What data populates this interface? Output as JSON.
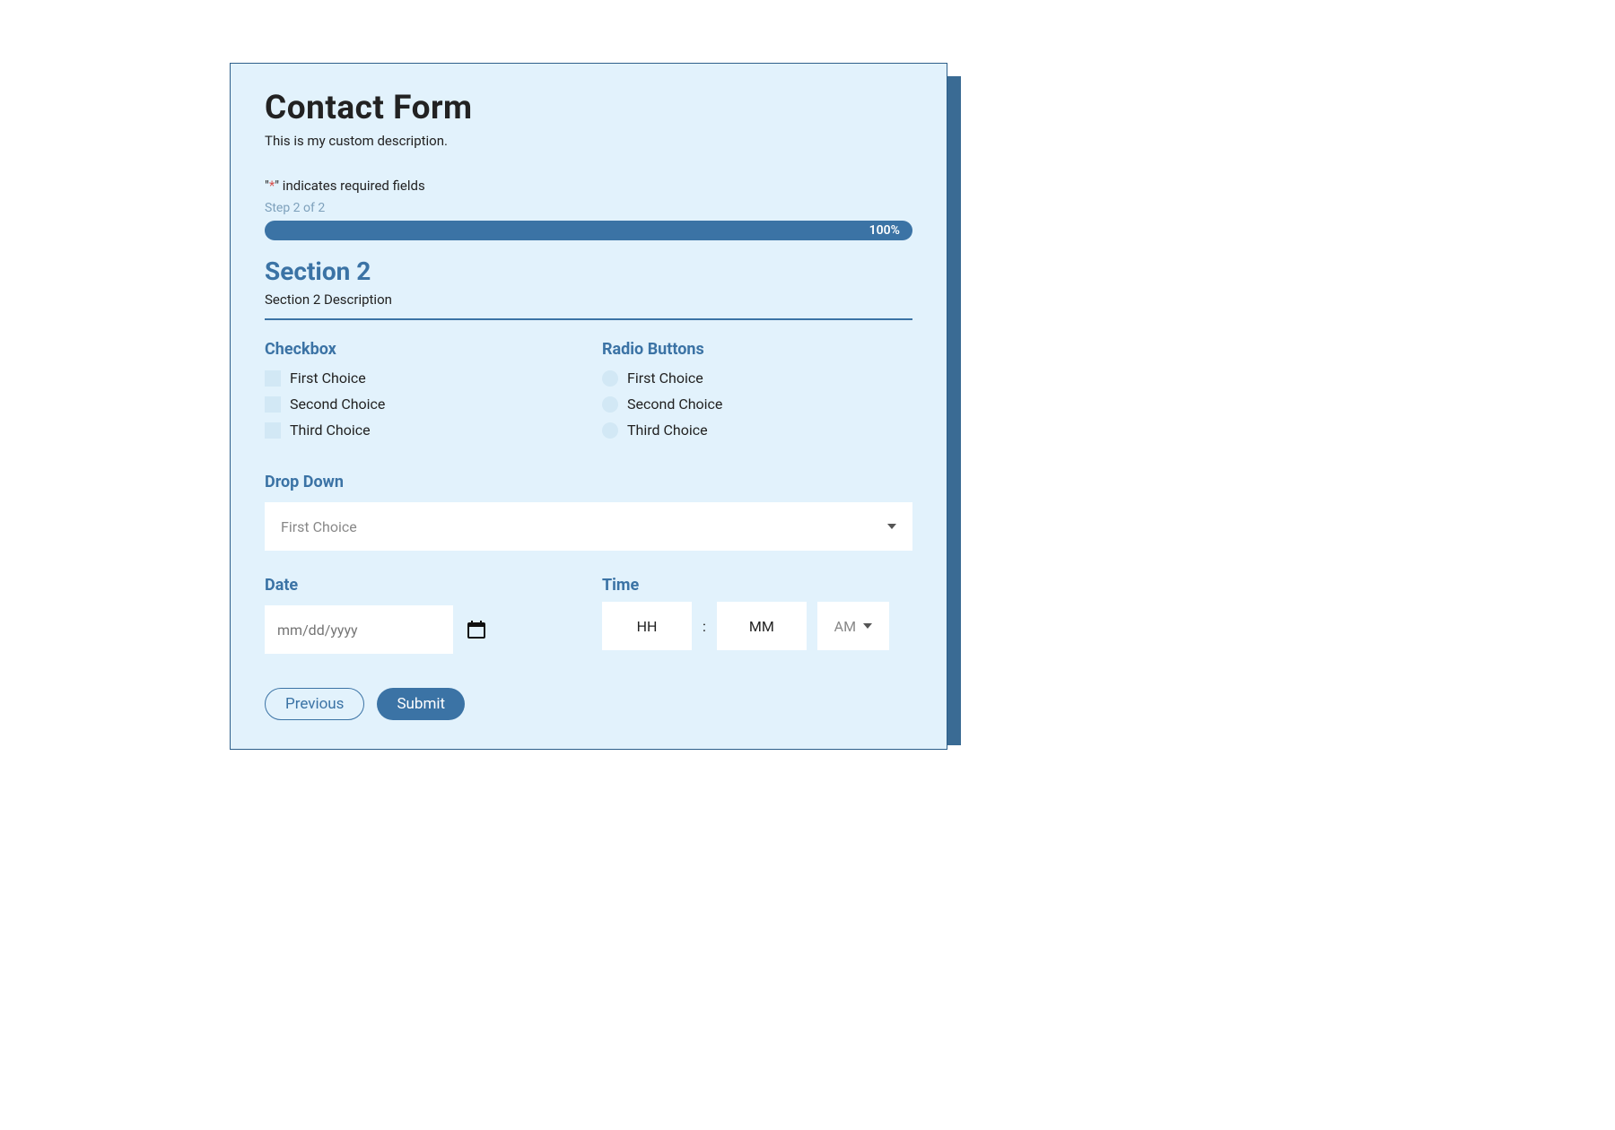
{
  "form": {
    "title": "Contact Form",
    "description": "This is my custom description.",
    "required_hint_prefix": "\"",
    "required_hint_ast": "*",
    "required_hint_suffix": "\" indicates required fields",
    "step_text": "Step 2 of 2",
    "progress_pct": "100%"
  },
  "section": {
    "title": "Section 2",
    "description": "Section 2 Description"
  },
  "checkbox": {
    "label": "Checkbox",
    "options": [
      "First Choice",
      "Second Choice",
      "Third Choice"
    ]
  },
  "radio": {
    "label": "Radio Buttons",
    "options": [
      "First Choice",
      "Second Choice",
      "Third Choice"
    ]
  },
  "dropdown": {
    "label": "Drop Down",
    "selected": "First Choice"
  },
  "date": {
    "label": "Date",
    "placeholder": "mm/dd/yyyy"
  },
  "time": {
    "label": "Time",
    "hh": "HH",
    "mm": "MM",
    "ampm": "AM"
  },
  "buttons": {
    "previous": "Previous",
    "submit": "Submit"
  }
}
